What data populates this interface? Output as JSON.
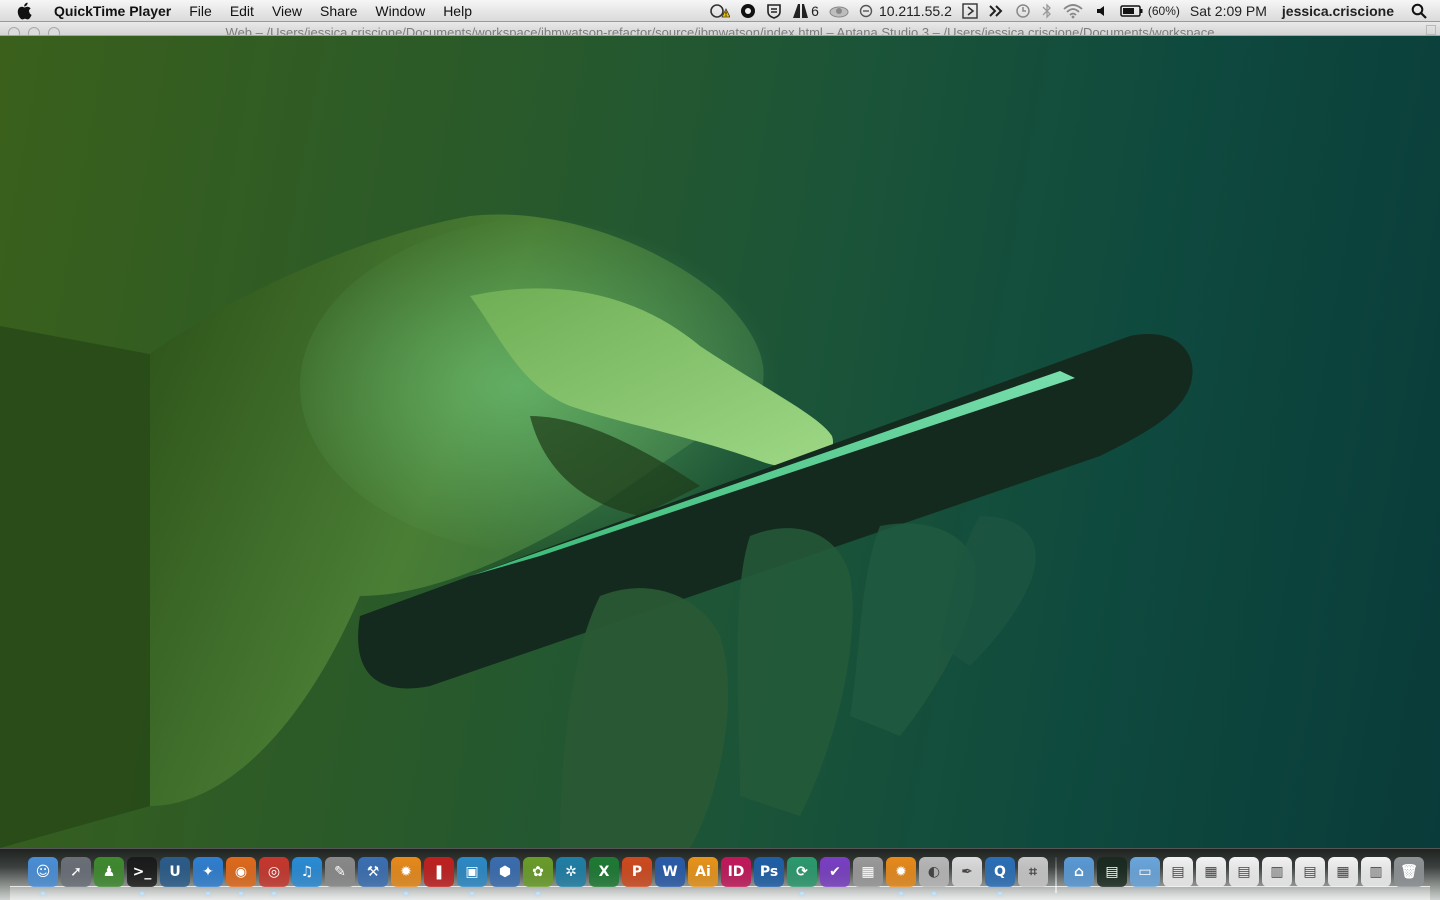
{
  "menubar": {
    "app_name": "QuickTime Player",
    "menus": [
      "File",
      "Edit",
      "View",
      "Share",
      "Window",
      "Help"
    ],
    "status": {
      "adobe_count": "6",
      "ip_address": "10.211.55.2",
      "battery": "(60%)",
      "clock": "Sat 2:09 PM",
      "user": "jessica.criscione"
    }
  },
  "window": {
    "title": "Web – /Users/jessica.criscione/Documents/workspace/ibmwatson-refactor/source/ibmwatson/index.html – Aptana Studio 3 – /Users/jessica.criscione/Documents/workspace"
  },
  "dock": {
    "apps": [
      {
        "icon": "finder-icon",
        "color": "#4a8fd8",
        "glyph": "☺",
        "lit": true
      },
      {
        "icon": "launchpad-icon",
        "color": "#6b6f78",
        "glyph": "➚",
        "lit": false
      },
      {
        "icon": "user-icon",
        "color": "#3f8a2f",
        "glyph": "♟",
        "lit": false
      },
      {
        "icon": "terminal-icon",
        "color": "#1a1a1a",
        "glyph": ">_",
        "lit": true
      },
      {
        "icon": "upload-icon",
        "color": "#2b5c8a",
        "glyph": "U",
        "lit": false
      },
      {
        "icon": "safari-icon",
        "color": "#2f7fd1",
        "glyph": "✦",
        "lit": true
      },
      {
        "icon": "firefox-icon",
        "color": "#e06a1c",
        "glyph": "◉",
        "lit": true
      },
      {
        "icon": "chrome-icon",
        "color": "#c7372e",
        "glyph": "◎",
        "lit": true
      },
      {
        "icon": "itunes-icon",
        "color": "#2a8cd6",
        "glyph": "♫",
        "lit": false
      },
      {
        "icon": "preview-icon",
        "color": "#8a8a8a",
        "glyph": "✎",
        "lit": false
      },
      {
        "icon": "xcode-icon",
        "color": "#3b6fb3",
        "glyph": "⚒",
        "lit": false
      },
      {
        "icon": "settings-icon",
        "color": "#e88a1a",
        "glyph": "✹",
        "lit": true
      },
      {
        "icon": "photo-booth-icon",
        "color": "#c02020",
        "glyph": "❚",
        "lit": false
      },
      {
        "icon": "remote-desktop-icon",
        "color": "#2c8ac7",
        "glyph": "▣",
        "lit": true
      },
      {
        "icon": "virtualbox-icon",
        "color": "#3a6db0",
        "glyph": "⬢",
        "lit": false
      },
      {
        "icon": "aptana-icon",
        "color": "#6a9d2a",
        "glyph": "✿",
        "lit": true
      },
      {
        "icon": "network-icon",
        "color": "#1f7fa6",
        "glyph": "✲",
        "lit": false
      },
      {
        "icon": "excel-icon",
        "color": "#1e7a34",
        "glyph": "X",
        "lit": false
      },
      {
        "icon": "powerpoint-icon",
        "color": "#d04a1e",
        "glyph": "P",
        "lit": false
      },
      {
        "icon": "word-icon",
        "color": "#2a5ba8",
        "glyph": "W",
        "lit": false
      },
      {
        "icon": "illustrator-icon",
        "color": "#e8941a",
        "glyph": "Ai",
        "lit": false
      },
      {
        "icon": "indesign-icon",
        "color": "#c2185b",
        "glyph": "ID",
        "lit": false
      },
      {
        "icon": "photoshop-icon",
        "color": "#1e5fa8",
        "glyph": "Ps",
        "lit": false
      },
      {
        "icon": "sync-icon",
        "color": "#2b9a6e",
        "glyph": "⟳",
        "lit": true
      },
      {
        "icon": "omnifocus-icon",
        "color": "#7a3fc4",
        "glyph": "✔",
        "lit": false
      },
      {
        "icon": "calculator-icon",
        "color": "#9a9a9a",
        "glyph": "▦",
        "lit": false
      },
      {
        "icon": "system-preferences-icon",
        "color": "#e88a1a",
        "glyph": "✹",
        "lit": true
      },
      {
        "icon": "disk-utility-icon",
        "color": "#b8b8b8",
        "glyph": "◐",
        "lit": true
      },
      {
        "icon": "textedit-icon",
        "color": "#dcdcdc",
        "glyph": "✒",
        "lit": false
      },
      {
        "icon": "quicktime-icon",
        "color": "#2a6fb8",
        "glyph": "Q",
        "lit": true
      },
      {
        "icon": "archive-utility-icon",
        "color": "#c8c8c8",
        "glyph": "⌗",
        "lit": false
      }
    ],
    "folders": [
      {
        "icon": "applications-folder-icon",
        "color": "#5a9ad6",
        "glyph": "⌂"
      },
      {
        "icon": "downloads-stack-icon",
        "color": "#1a2a20",
        "glyph": "▤"
      },
      {
        "icon": "documents-folder-icon",
        "color": "#6aa6dd",
        "glyph": "▭"
      },
      {
        "icon": "document-thumbnail-icon",
        "color": "#f2f2f2",
        "glyph": "▤"
      },
      {
        "icon": "document-thumbnail-icon",
        "color": "#f2f2f2",
        "glyph": "▦"
      },
      {
        "icon": "document-thumbnail-icon",
        "color": "#f2f2f2",
        "glyph": "▤"
      },
      {
        "icon": "document-thumbnail-icon",
        "color": "#f2f2f2",
        "glyph": "▥"
      },
      {
        "icon": "document-thumbnail-icon",
        "color": "#f2f2f2",
        "glyph": "▤"
      },
      {
        "icon": "document-thumbnail-icon",
        "color": "#f2f2f2",
        "glyph": "▦"
      },
      {
        "icon": "document-thumbnail-icon",
        "color": "#f2f2f2",
        "glyph": "▥"
      },
      {
        "icon": "trash-icon",
        "color": "#8e9295",
        "glyph": "🗑"
      }
    ]
  }
}
